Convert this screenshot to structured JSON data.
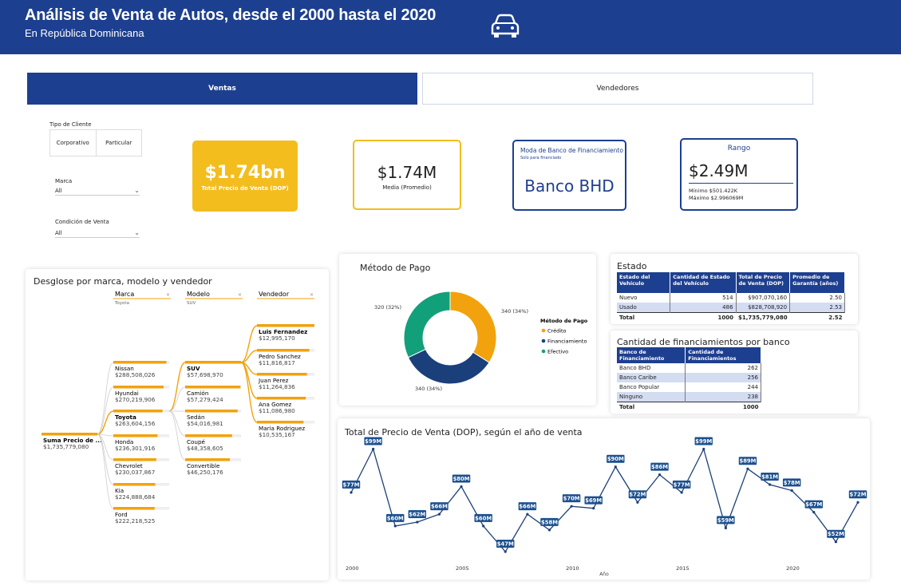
{
  "header": {
    "title": "Análisis de Venta de Autos, desde el 2000 hasta el 2020",
    "subtitle": "En República Dominicana"
  },
  "tabs": [
    "Ventas",
    "Vendedores"
  ],
  "filters": {
    "tipo_label": "Tipo de Cliente",
    "tipo_options": [
      "Corporativo",
      "Particular"
    ],
    "marca_label": "Marca",
    "marca_value": "All",
    "condicion_label": "Condición de Venta",
    "condicion_value": "All"
  },
  "kpis": {
    "total_value": "$1.74bn",
    "total_label": "Total Precio de Venta (DOP)",
    "media_value": "$1.74M",
    "media_label": "Media (Promedio)",
    "moda_title": "Moda de Banco de Financiamiento",
    "moda_note": "Solo para financiado",
    "moda_value": "Banco BHD",
    "rango_title": "Rango",
    "rango_value": "$2.49M",
    "rango_min": "Mínimo $501.422K",
    "rango_max": "Máximo $2.996069M"
  },
  "decomp": {
    "title": "Desglose por marca, modelo y vendedor",
    "headers": [
      {
        "name": "Marca",
        "filter": "Toyota"
      },
      {
        "name": "Modelo",
        "filter": "SUV"
      },
      {
        "name": "Vendedor",
        "filter": ""
      }
    ],
    "root": {
      "label": "Suma Precio de ...",
      "value": "$1,735,779,080",
      "bar": 1.0
    },
    "brands": [
      {
        "label": "Nissan",
        "value": "$288,508,026",
        "bar": 0.95
      },
      {
        "label": "Hyundai",
        "value": "$270,219,906",
        "bar": 0.9
      },
      {
        "label": "Toyota",
        "value": "$263,604,156",
        "bar": 0.88,
        "selected": true
      },
      {
        "label": "Honda",
        "value": "$236,301,916",
        "bar": 0.79
      },
      {
        "label": "Chevrolet",
        "value": "$230,037,867",
        "bar": 0.77
      },
      {
        "label": "Kia",
        "value": "$224,888,684",
        "bar": 0.75
      },
      {
        "label": "Ford",
        "value": "$222,218,525",
        "bar": 0.74
      }
    ],
    "models": [
      {
        "label": "SUV",
        "value": "$57,698,970",
        "bar": 1.0,
        "selected": true
      },
      {
        "label": "Camión",
        "value": "$57,279,424",
        "bar": 0.99
      },
      {
        "label": "Sedán",
        "value": "$54,016,981",
        "bar": 0.94
      },
      {
        "label": "Coupé",
        "value": "$48,358,605",
        "bar": 0.84
      },
      {
        "label": "Convertible",
        "value": "$46,250,176",
        "bar": 0.8
      }
    ],
    "sellers": [
      {
        "label": "Luis Fernandez",
        "value": "$12,995,170",
        "bar": 1.0,
        "bold": true
      },
      {
        "label": "Pedro Sanchez",
        "value": "$11,816,817",
        "bar": 0.91
      },
      {
        "label": "Juan Perez",
        "value": "$11,264,836",
        "bar": 0.87
      },
      {
        "label": "Ana Gomez",
        "value": "$11,086,980",
        "bar": 0.85
      },
      {
        "label": "Maria Rodriguez",
        "value": "$10,535,167",
        "bar": 0.81
      }
    ]
  },
  "payment": {
    "title": "Método de Pago",
    "legend_title": "Método de Pago",
    "slices": [
      {
        "name": "Crédito",
        "value": 340,
        "label": "340 (34%)",
        "color": "#f2a20c"
      },
      {
        "name": "Financiamiento",
        "value": 340,
        "label": "340 (34%)",
        "color": "#1b3f7a"
      },
      {
        "name": "Efectivo",
        "value": 320,
        "label": "320 (32%)",
        "color": "#12a07a"
      }
    ]
  },
  "estado": {
    "title": "Estado",
    "headers": [
      "Estado del Vehículo",
      "Cantidad de Estado del Vehículo",
      "Total de Precio de Venta (DOP)",
      "Promedio de Garantía (años)"
    ],
    "rows": [
      [
        "Nuevo",
        "514",
        "$907,070,160",
        "2.50"
      ],
      [
        "Usado",
        "486",
        "$828,708,920",
        "2.53"
      ]
    ],
    "total": [
      "Total",
      "1000",
      "$1,735,779,080",
      "2.52"
    ]
  },
  "financ": {
    "title": "Cantidad de financiamientos por banco",
    "headers": [
      "Banco de Financiamiento",
      "Cantidad de Financiamientos"
    ],
    "rows": [
      [
        "Banco BHD",
        "262"
      ],
      [
        "Banco Caribe",
        "256"
      ],
      [
        "Banco Popular",
        "244"
      ],
      [
        "Ninguno",
        "238"
      ]
    ],
    "total": [
      "Total",
      "1000"
    ]
  },
  "line": {
    "title": "Total de Precio de Venta (DOP), según el año de venta",
    "xlabel": "Año",
    "xticks": [
      "2000",
      "2005",
      "2010",
      "2015",
      "2020"
    ]
  },
  "chart_data": {
    "type": "line",
    "title": "Total de Precio de Venta (DOP), según el año de venta",
    "xlabel": "Año",
    "ylabel": "",
    "x": [
      2000,
      2001,
      2002,
      2003,
      2004,
      2005,
      2006,
      2007,
      2008,
      2009,
      2010,
      2011,
      2012,
      2013,
      2014,
      2015,
      2016,
      2017,
      2018,
      2019,
      2020,
      2021,
      2022
    ],
    "values": [
      77,
      99,
      60,
      62,
      66,
      80,
      60,
      47,
      66,
      58,
      70,
      69,
      90,
      72,
      86,
      77,
      99,
      59,
      89,
      81,
      78,
      67,
      52,
      72
    ],
    "labels": [
      "$77M",
      "$99M",
      "$60M",
      "$62M",
      "$66M",
      "$80M",
      "$60M",
      "$47M",
      "$66M",
      "$58M",
      "$70M",
      "$69M",
      "$90M",
      "$72M",
      "$86M",
      "$77M",
      "$99M",
      "$59M",
      "$89M",
      "$81M",
      "$78M",
      "$67M",
      "$52M",
      "$72M"
    ],
    "color": "#1b3f7a",
    "grid": false
  }
}
